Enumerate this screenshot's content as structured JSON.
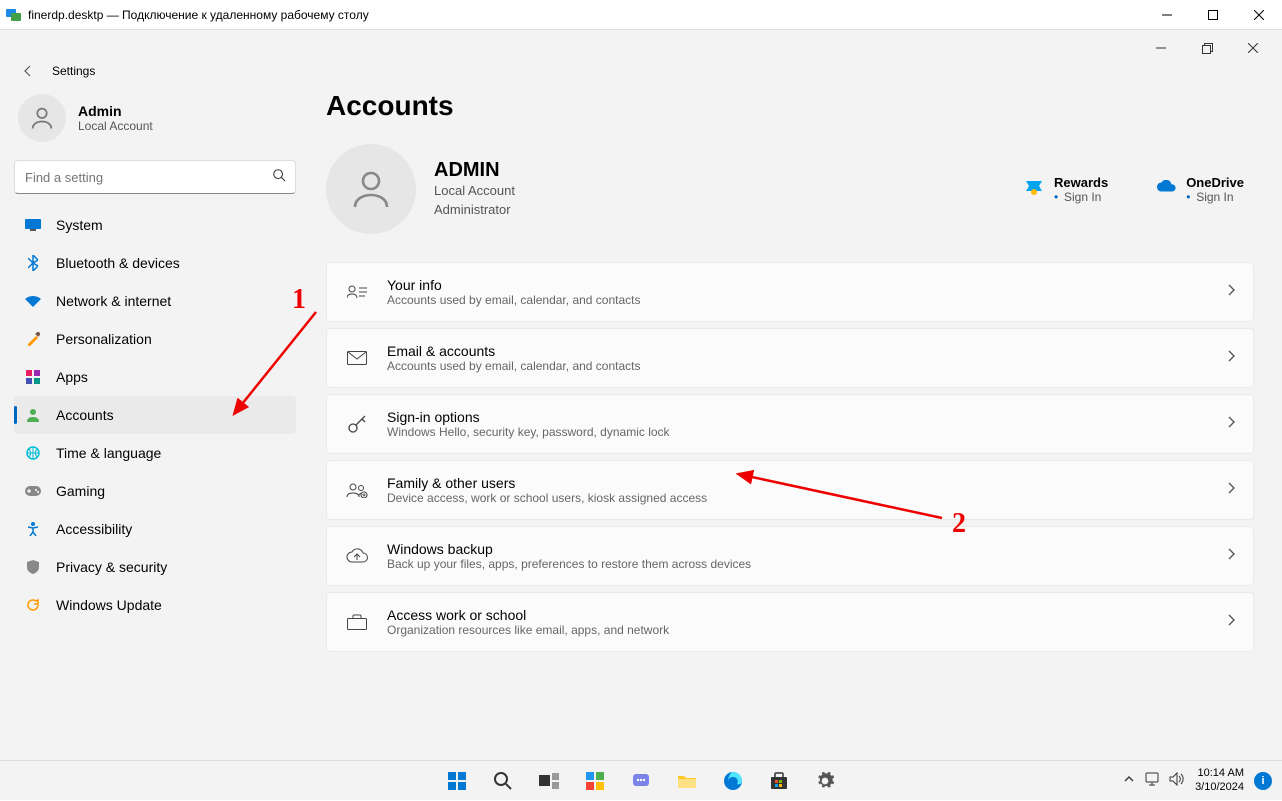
{
  "rdp": {
    "title": "finerdp.desktp — Подключение к удаленному рабочему столу"
  },
  "settings_label": "Settings",
  "user": {
    "name": "Admin",
    "sub": "Local Account"
  },
  "search": {
    "placeholder": "Find a setting"
  },
  "nav": [
    {
      "label": "System",
      "icon": "🖥️",
      "active": false
    },
    {
      "label": "Bluetooth & devices",
      "icon": "ᛒ",
      "active": false
    },
    {
      "label": "Network & internet",
      "icon": "📶",
      "active": false
    },
    {
      "label": "Personalization",
      "icon": "🖌️",
      "active": false
    },
    {
      "label": "Apps",
      "icon": "▦",
      "active": false
    },
    {
      "label": "Accounts",
      "icon": "👤",
      "active": true
    },
    {
      "label": "Time & language",
      "icon": "🌐",
      "active": false
    },
    {
      "label": "Gaming",
      "icon": "🎮",
      "active": false
    },
    {
      "label": "Accessibility",
      "icon": "♿",
      "active": false
    },
    {
      "label": "Privacy & security",
      "icon": "🛡️",
      "active": false
    },
    {
      "label": "Windows Update",
      "icon": "🔄",
      "active": false
    }
  ],
  "page": {
    "title": "Accounts",
    "account": {
      "name": "ADMIN",
      "line1": "Local Account",
      "line2": "Administrator"
    },
    "rewards": {
      "title": "Rewards",
      "link": "Sign In"
    },
    "onedrive": {
      "title": "OneDrive",
      "link": "Sign In"
    }
  },
  "cards": [
    {
      "title": "Your info",
      "sub": "Accounts used by email, calendar, and contacts",
      "icon": "person-card"
    },
    {
      "title": "Email & accounts",
      "sub": "Accounts used by email, calendar, and contacts",
      "icon": "mail"
    },
    {
      "title": "Sign-in options",
      "sub": "Windows Hello, security key, password, dynamic lock",
      "icon": "key"
    },
    {
      "title": "Family & other users",
      "sub": "Device access, work or school users, kiosk assigned access",
      "icon": "people"
    },
    {
      "title": "Windows backup",
      "sub": "Back up your files, apps, preferences to restore them across devices",
      "icon": "backup"
    },
    {
      "title": "Access work or school",
      "sub": "Organization resources like email, apps, and network",
      "icon": "briefcase"
    }
  ],
  "annotations": {
    "n1": "1",
    "n2": "2"
  },
  "taskbar": {
    "time": "10:14 AM",
    "date": "3/10/2024"
  }
}
